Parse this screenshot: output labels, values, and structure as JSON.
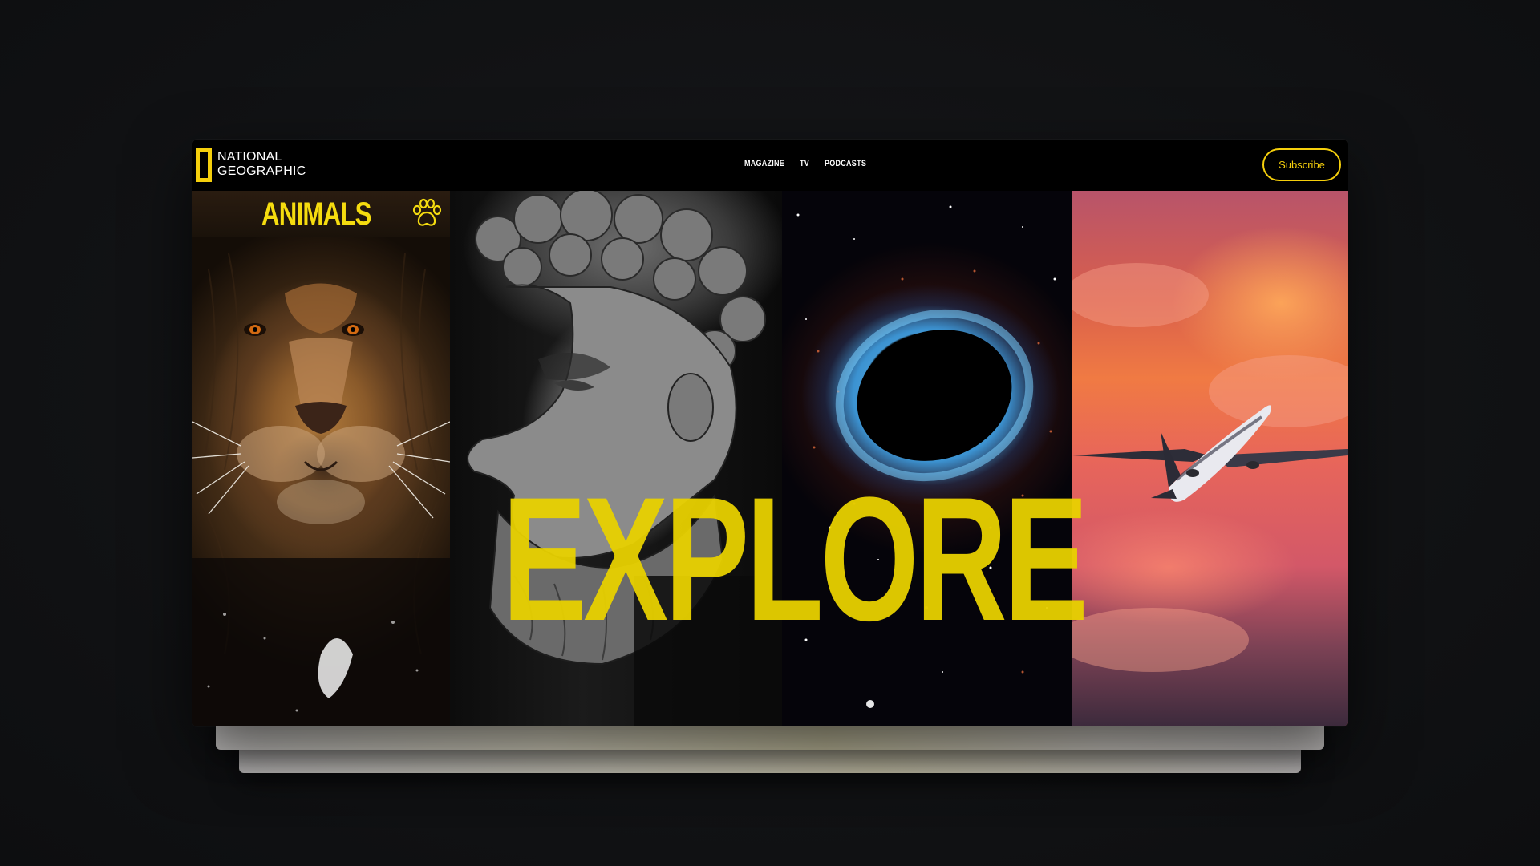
{
  "brand": {
    "line1": "NATIONAL",
    "line2": "GEOGRAPHIC",
    "accent_color": "#f5cf0c"
  },
  "nav": {
    "links": [
      "MAGAZINE",
      "TV",
      "PODCASTS"
    ],
    "subscribe_label": "Subscribe"
  },
  "hero": {
    "headline": "EXPLORE",
    "headline_color": "#e8d100",
    "panels": [
      {
        "title": "ANIMALS",
        "icon": "paw-icon"
      },
      {
        "title": "",
        "icon": ""
      },
      {
        "title": "",
        "icon": ""
      },
      {
        "title": "",
        "icon": ""
      }
    ]
  }
}
